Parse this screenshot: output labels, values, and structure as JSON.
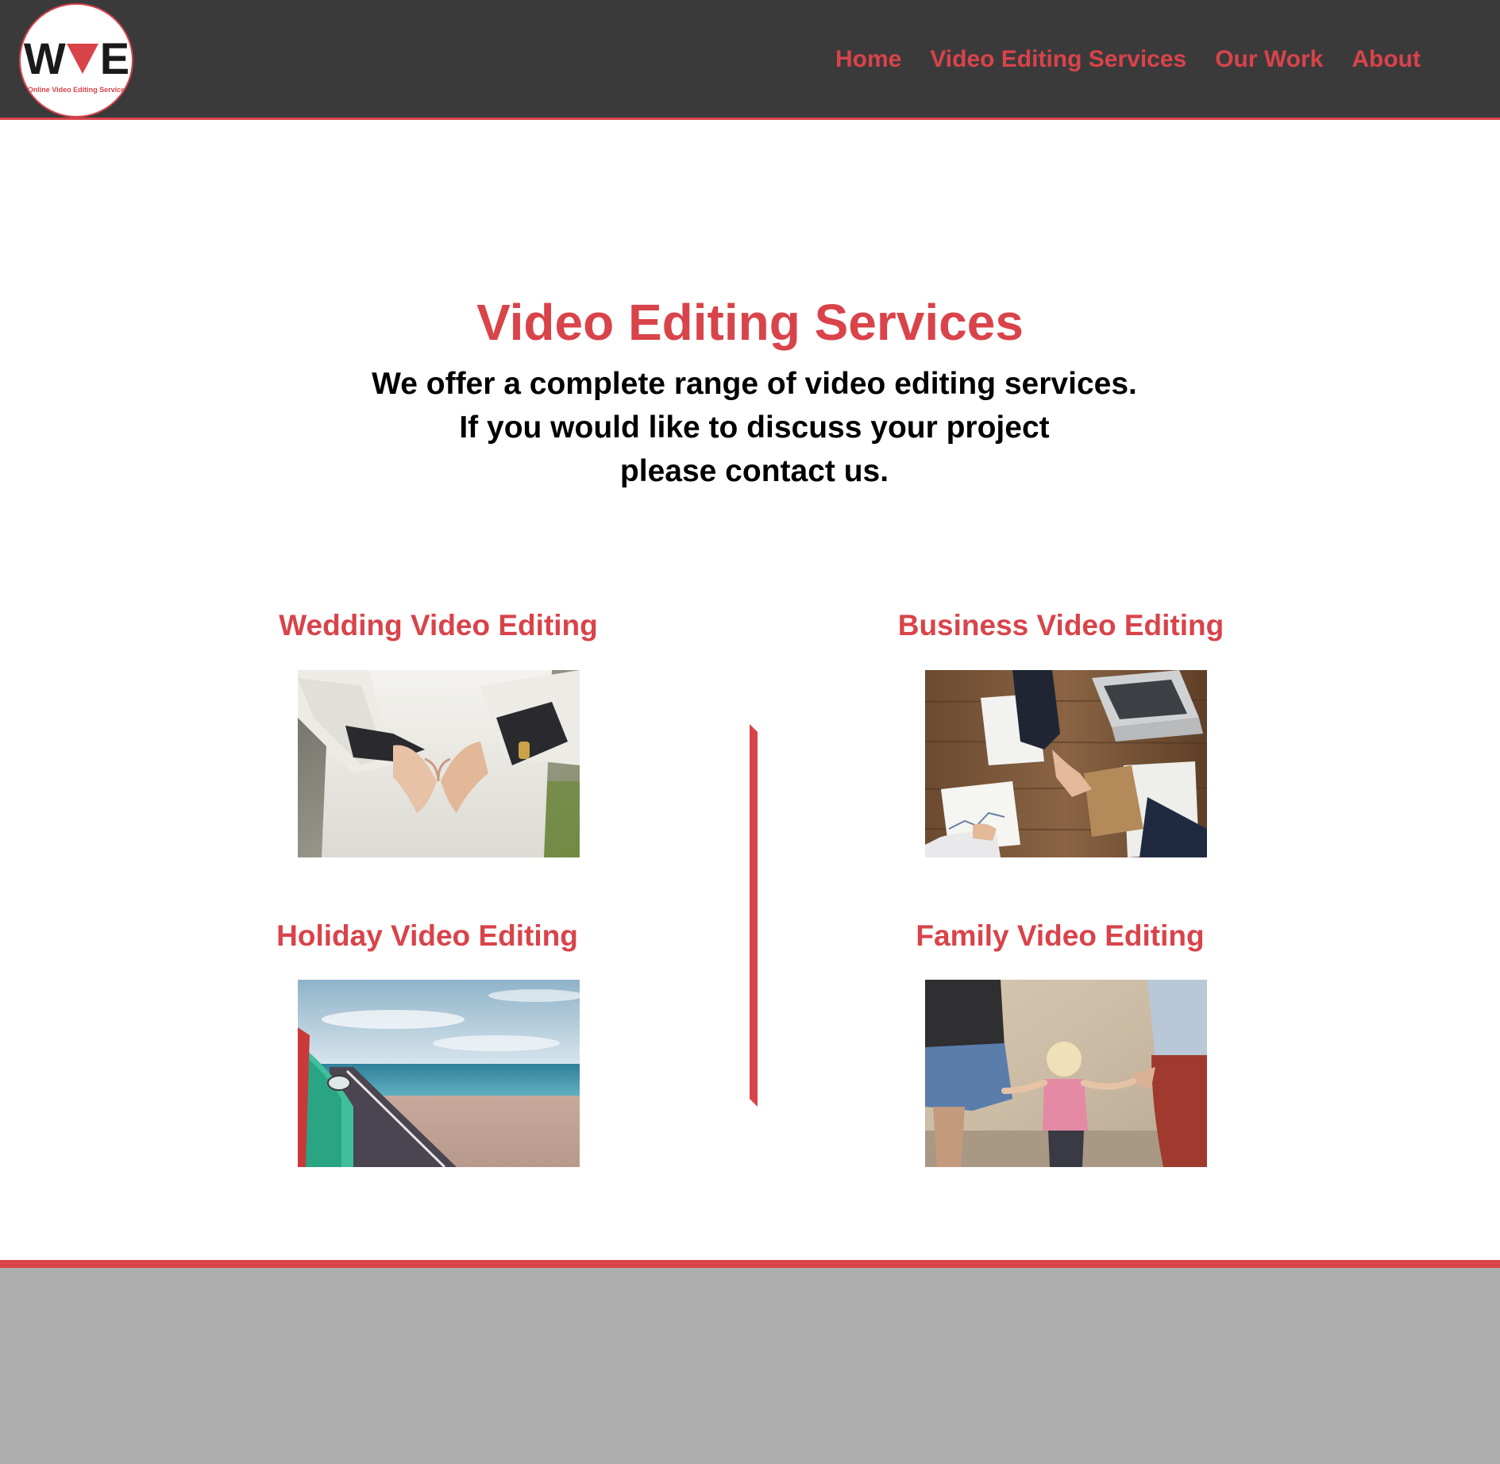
{
  "brand": {
    "letters_left": "W",
    "letters_right": "E",
    "tagline": "Online Video Editing Service",
    "accent_color": "#d9434a",
    "header_bg": "#3b3a3b",
    "footer_bg": "#adadad"
  },
  "nav": {
    "items": [
      {
        "label": "Home"
      },
      {
        "label": "Video Editing Services"
      },
      {
        "label": "Our Work"
      },
      {
        "label": "About"
      }
    ]
  },
  "hero": {
    "title": "Video Editing Services",
    "lines": [
      "We offer a complete range of video editing services.",
      "If you would like to discuss your project",
      "please contact us."
    ]
  },
  "services": [
    {
      "title": "Wedding Video Editing",
      "image": "wedding-hands-heart-photo"
    },
    {
      "title": "Business Video Editing",
      "image": "business-handshake-desk-photo"
    },
    {
      "title": "Holiday Video Editing",
      "image": "coastal-road-car-photo"
    },
    {
      "title": "Family Video Editing",
      "image": "family-holding-hands-photo"
    }
  ]
}
